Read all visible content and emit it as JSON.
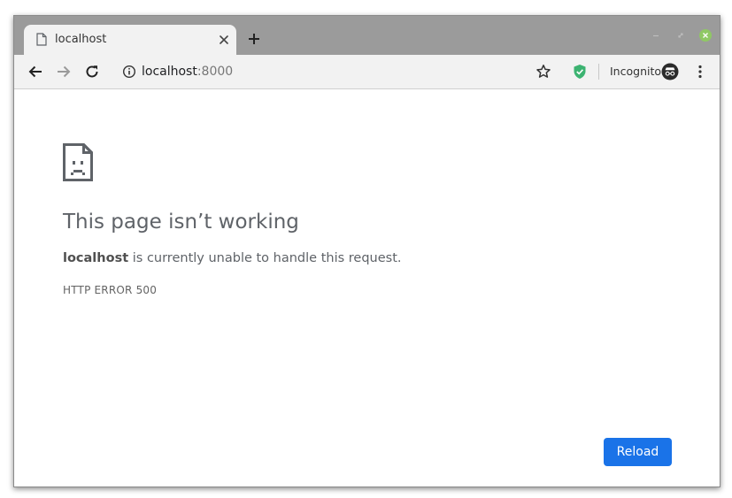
{
  "tab": {
    "title": "localhost",
    "favicon": "page-icon"
  },
  "window_controls": {
    "close_color": "#8fc864"
  },
  "toolbar": {
    "url_host": "localhost",
    "url_port": ":8000",
    "incognito_label": "Incognito",
    "shield_color": "#3cb371"
  },
  "error": {
    "icon": "sad-page-icon",
    "heading": "This page isn’t working",
    "host": "localhost",
    "message": " is currently unable to handle this request.",
    "code": "HTTP ERROR 500",
    "reload_label": "Reload",
    "accent": "#1a73e8"
  }
}
